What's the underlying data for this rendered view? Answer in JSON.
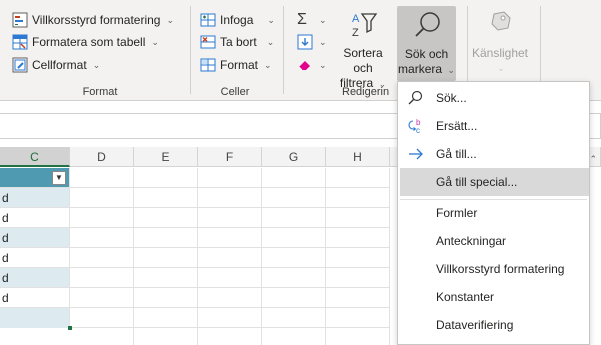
{
  "ribbon": {
    "format_group": {
      "label": "Format",
      "conditional_formatting": "Villkorsstyrd formatering",
      "format_as_table": "Formatera som tabell",
      "cell_styles": "Cellformat"
    },
    "cells_group": {
      "label": "Celler",
      "insert": "Infoga",
      "delete": "Ta bort",
      "format": "Format"
    },
    "editing_group": {
      "label": "Redigerin",
      "autosum_icon": "sigma-icon",
      "fill_icon": "fill-down-icon",
      "clear_icon": "eraser-icon",
      "sort_filter_line1": "Sortera och",
      "sort_filter_line2": "filtrera",
      "find_select_line1": "Sök och",
      "find_select_line2": "markera"
    },
    "sensitivity": {
      "label": "Känslighet"
    }
  },
  "columns": [
    "C",
    "D",
    "E",
    "F",
    "G",
    "H"
  ],
  "cells_c": [
    "d",
    "d",
    "d",
    "d",
    "d",
    "d"
  ],
  "menu": {
    "items": [
      {
        "label": "Sök...",
        "icon": "search-icon"
      },
      {
        "label": "Ersätt...",
        "icon": "replace-icon"
      },
      {
        "label": "Gå till...",
        "icon": "arrow-right-icon"
      },
      {
        "label": "Gå till special...",
        "icon": ""
      },
      {
        "label": "Formler",
        "icon": ""
      },
      {
        "label": "Anteckningar",
        "icon": ""
      },
      {
        "label": "Villkorsstyrd formatering",
        "icon": ""
      },
      {
        "label": "Konstanter",
        "icon": ""
      },
      {
        "label": "Dataverifiering",
        "icon": ""
      }
    ]
  },
  "colors": {
    "ribbon_bg": "#f3f2f1",
    "table_header": "#4f9ab0",
    "table_band": "#ddebf0",
    "hover": "#d9d9d9",
    "accent_blue": "#2b79d0"
  }
}
